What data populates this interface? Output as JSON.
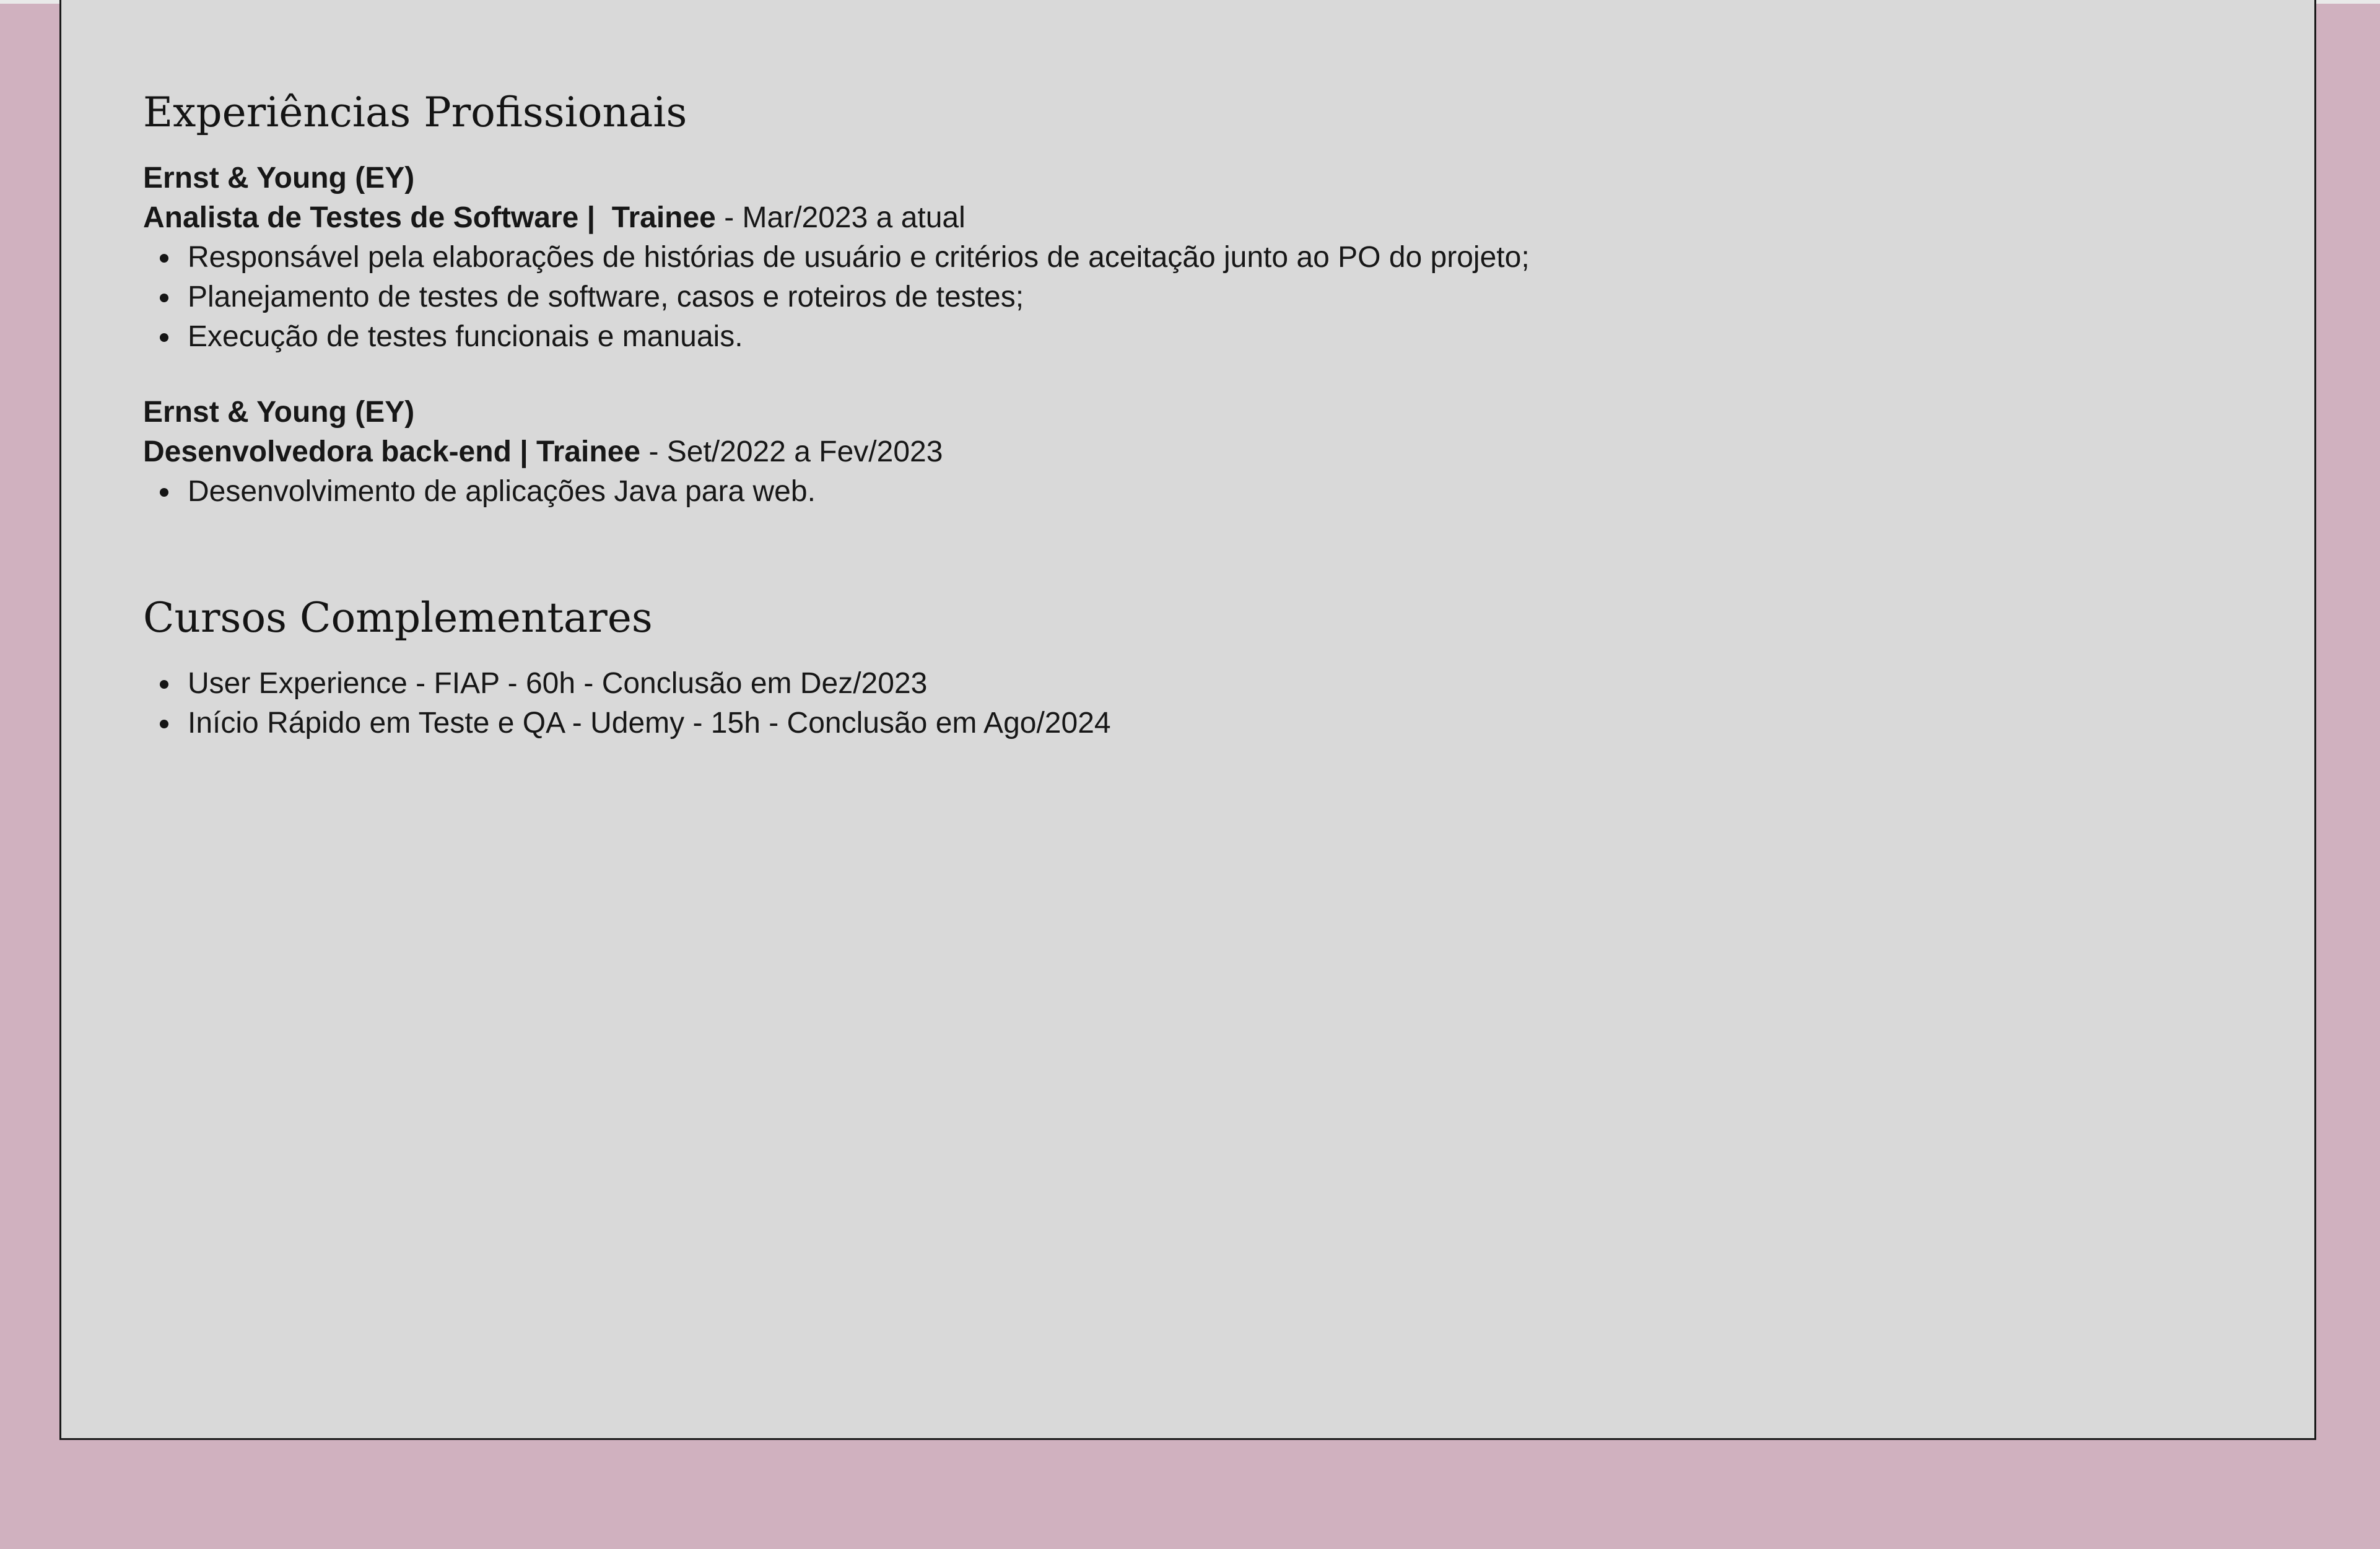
{
  "experiences": {
    "title": "Experiências Profissionais",
    "items": [
      {
        "company": "Ernst & Young (EY)",
        "role_part1": "Analista de Testes de Software |",
        "role_part2": "Trainee",
        "period": "- Mar/2023 a atual",
        "bullets": [
          "Responsável pela elaborações de histórias de usuário e critérios de aceitação junto ao PO do projeto;",
          "Planejamento de testes de software, casos e roteiros de testes;",
          "Execução de testes funcionais e manuais."
        ]
      },
      {
        "company": "Ernst & Young (EY)",
        "role_part1": "Desenvolvedora back-end |",
        "role_part2": "Trainee",
        "period": "- Set/2022 a Fev/2023",
        "bullets": [
          "Desenvolvimento de aplicações Java para web."
        ]
      }
    ]
  },
  "courses": {
    "title": "Cursos Complementares",
    "items": [
      "User Experience - FIAP - 60h - Conclusão em Dez/2023",
      "Início Rápido em Teste e QA - Udemy - 15h - Conclusão em Ago/2024"
    ]
  },
  "colors": {
    "background": "#d0b1bf",
    "card": "#d9d9d9",
    "text": "#151515"
  }
}
